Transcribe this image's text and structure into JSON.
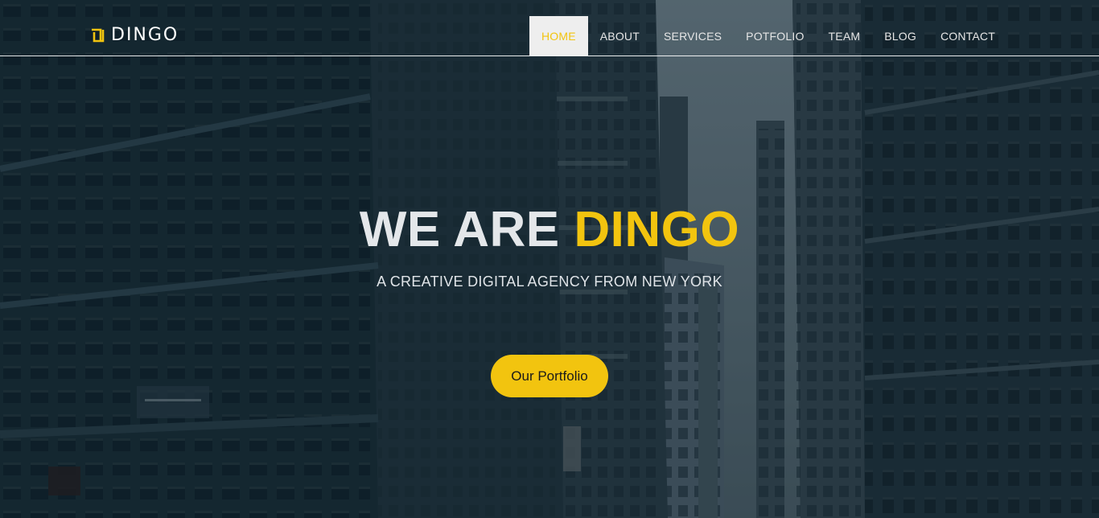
{
  "brand": {
    "name": "DINGO",
    "accent_color": "#f2c40f",
    "icon": "dingo-logo-icon"
  },
  "nav": {
    "items": [
      {
        "label": "HOME",
        "active": true
      },
      {
        "label": "ABOUT",
        "active": false
      },
      {
        "label": "SERVICES",
        "active": false
      },
      {
        "label": "POTFOLIO",
        "active": false
      },
      {
        "label": "TEAM",
        "active": false
      },
      {
        "label": "BLOG",
        "active": false
      },
      {
        "label": "CONTACT",
        "active": false
      }
    ]
  },
  "hero": {
    "headline_part1": "WE ARE",
    "headline_part2": "DINGO",
    "tagline": "A CREATIVE DIGITAL AGENCY FROM NEW YORK",
    "cta_label": "Our Portfolio",
    "background": "city-street-skyscrapers-photo"
  },
  "colors": {
    "accent": "#f2c40f",
    "overlay": "#0a202c",
    "nav_active_bg": "#eeeeee"
  }
}
